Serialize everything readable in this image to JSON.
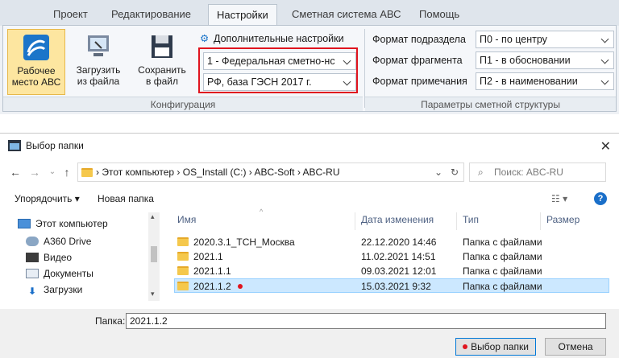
{
  "ribbon": {
    "tabs": [
      {
        "label": "Проект"
      },
      {
        "label": "Редактирование"
      },
      {
        "label": "Настройки"
      },
      {
        "label": "Сметная система АВС"
      },
      {
        "label": "Помощь"
      }
    ],
    "active_tab": "Настройки",
    "buttons": {
      "workspace_line1": "Рабочее",
      "workspace_line2": "место АВС",
      "load_line1": "Загрузить",
      "load_line2": "из файла",
      "save_line1": "Сохранить",
      "save_line2": "в файл"
    },
    "extra_settings": "Дополнительные настройки",
    "combo_federal": "1 - Федеральная сметно-нс",
    "combo_base": "РФ, база ГЭСН 2017 г.",
    "group_config": "Конфигурация",
    "format_section_label": "Формат подраздела",
    "format_section_value": "П0 - по центру",
    "format_fragment_label": "Формат фрагмента",
    "format_fragment_value": "П1 - в обосновании",
    "format_note_label": "Формат примечания",
    "format_note_value": "П2 - в наименовании",
    "group_params": "Параметры сметной структуры",
    "accent_color": "#e0141e"
  },
  "dialog": {
    "title": "Выбор папки",
    "breadcrumb": [
      "Этот компьютер",
      "OS_Install (C:)",
      "ABC-Soft",
      "ABC-RU"
    ],
    "search_placeholder": "Поиск: ABC-RU",
    "organize": "Упорядочить ▾",
    "new_folder": "Новая папка",
    "tree": [
      {
        "label": "Этот компьютер",
        "icon": "computer-icon"
      },
      {
        "label": "A360 Drive",
        "icon": "cloud-drive-icon"
      },
      {
        "label": "Видео",
        "icon": "video-icon"
      },
      {
        "label": "Документы",
        "icon": "documents-icon"
      },
      {
        "label": "Загрузки",
        "icon": "downloads-icon"
      }
    ],
    "columns": {
      "name": "Имя",
      "date": "Дата изменения",
      "type": "Тип",
      "size": "Размер"
    },
    "rows": [
      {
        "name": "2020.3.1_ТСН_Москва",
        "date": "22.12.2020 14:46",
        "type": "Папка с файлами"
      },
      {
        "name": "2021.1",
        "date": "11.02.2021 14:51",
        "type": "Папка с файлами"
      },
      {
        "name": "2021.1.1",
        "date": "09.03.2021 12:01",
        "type": "Папка с файлами"
      },
      {
        "name": "2021.1.2",
        "date": "15.03.2021 9:32",
        "type": "Папка с файлами"
      }
    ],
    "selected_row": 3,
    "folder_label": "Папка:",
    "folder_value": "2021.1.2",
    "select_button": "Выбор папки",
    "cancel_button": "Отмена"
  }
}
